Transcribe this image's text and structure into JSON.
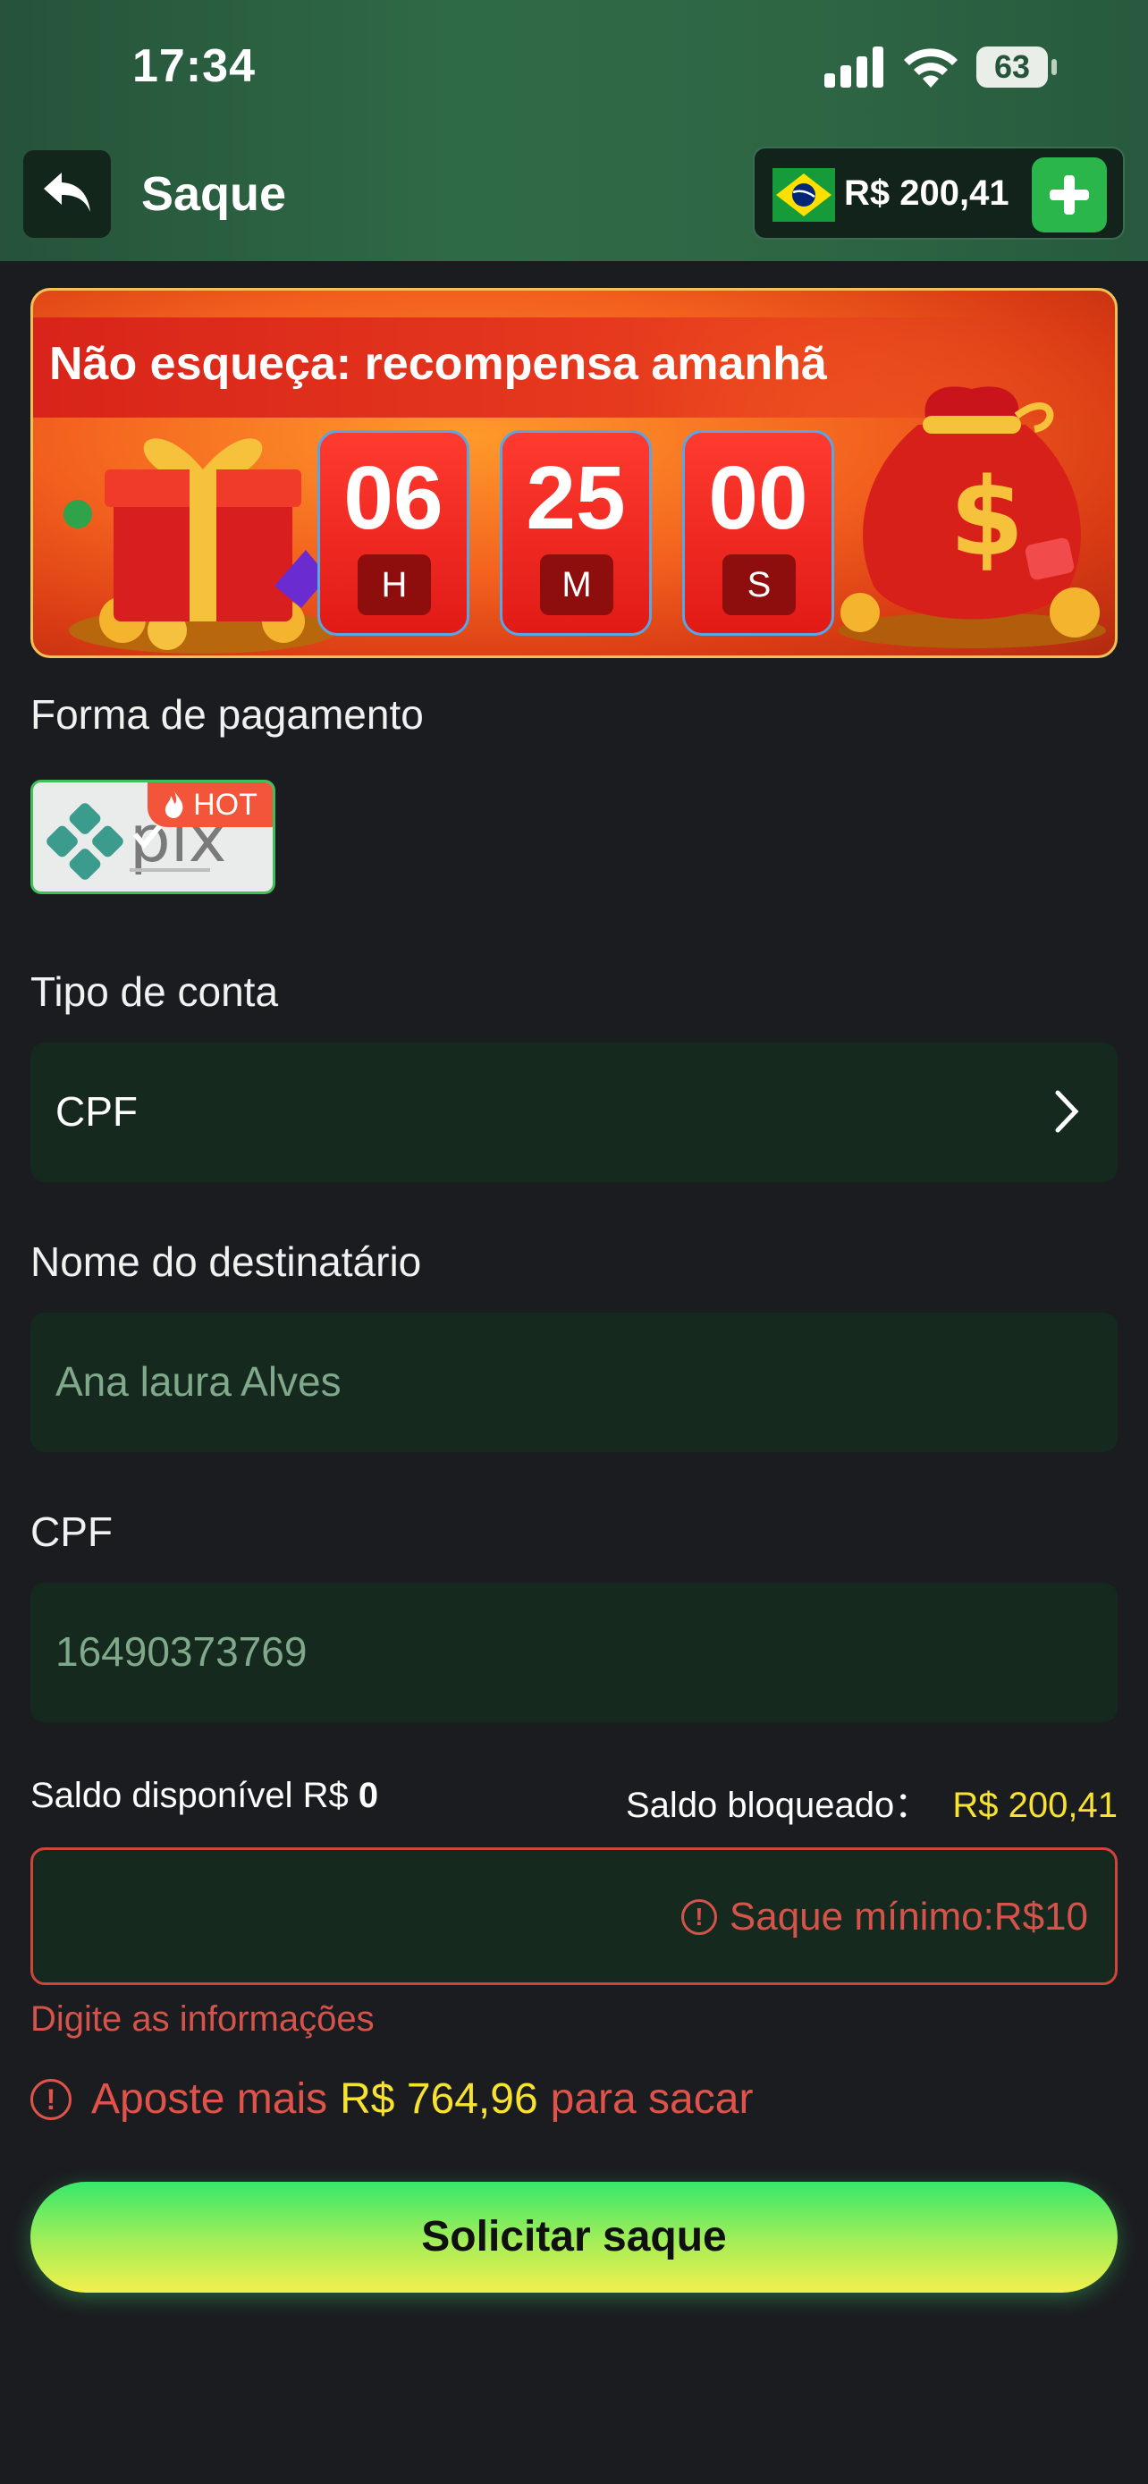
{
  "status_bar": {
    "time": "17:34",
    "battery": "63"
  },
  "header": {
    "title": "Saque",
    "balance": "R$ 200,41"
  },
  "banner": {
    "title": "Não esqueça: recompensa amanhã",
    "timer": [
      {
        "value": "06",
        "unit": "H"
      },
      {
        "value": "25",
        "unit": "M"
      },
      {
        "value": "00",
        "unit": "S"
      }
    ]
  },
  "payment": {
    "label": "Forma de pagamento",
    "method": "pix",
    "badge": "HOT"
  },
  "account_type": {
    "label": "Tipo de conta",
    "value": "CPF"
  },
  "recipient": {
    "label": "Nome do destinatário",
    "value": "Ana laura Alves"
  },
  "cpf": {
    "label": "CPF",
    "value": "16490373769"
  },
  "saldo": {
    "available_label": "Saldo disponível R$",
    "available_value": "0",
    "blocked_label": "Saldo bloqueado：",
    "blocked_value": "R$ 200,41"
  },
  "amount": {
    "hint": "Saque mínimo:R$10"
  },
  "error": {
    "text": "Digite as informações"
  },
  "warning": {
    "prefix": "Aposte mais",
    "amount": "R$ 764,96",
    "suffix": "para sacar"
  },
  "submit": {
    "label": "Solicitar saque"
  },
  "colors": {
    "accent_green": "#2bb64c",
    "error": "#d4534a",
    "highlight": "#f6e22f"
  }
}
